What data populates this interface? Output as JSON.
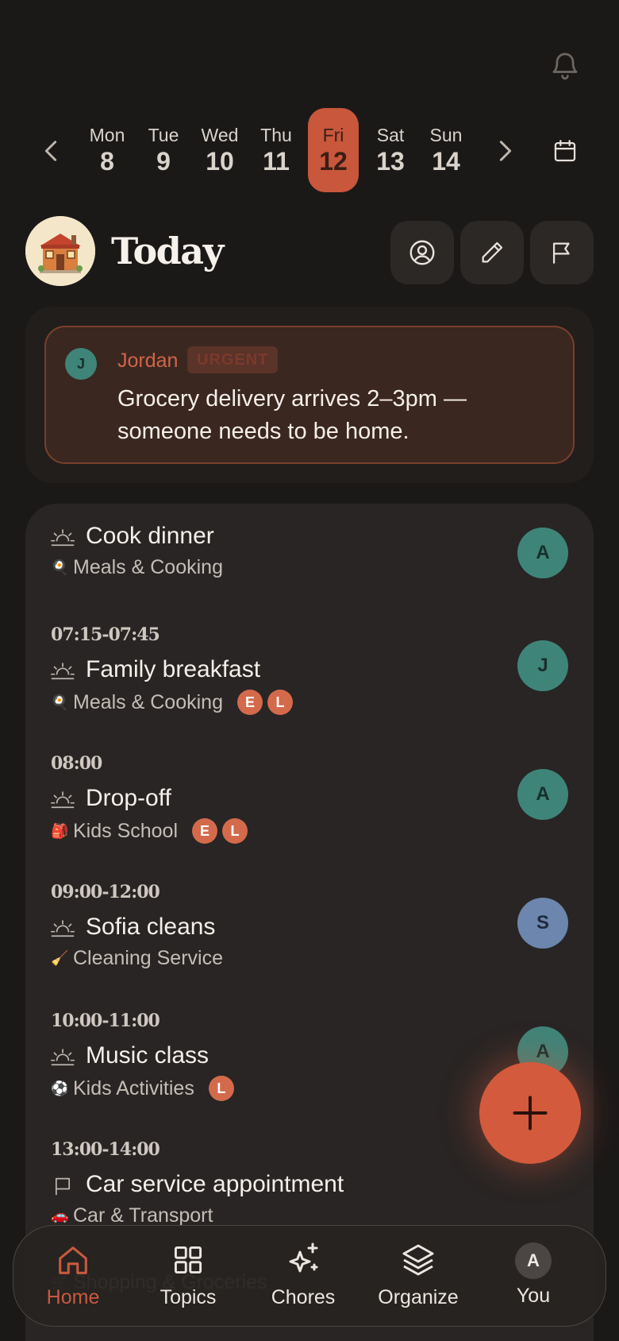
{
  "colors": {
    "background": "#1b1918",
    "accent": "#c8573b",
    "card": "#282524",
    "urgent_card": "#3a2720"
  },
  "header": {
    "notification_icon": "bell-icon",
    "title": "Today",
    "buttons": [
      {
        "icon": "user-circle-icon"
      },
      {
        "icon": "pencil-icon"
      },
      {
        "icon": "flag-icon"
      }
    ]
  },
  "week": {
    "prev_icon": "chevron-left-icon",
    "next_icon": "chevron-right-icon",
    "calendar_icon": "calendar-icon",
    "selected_index": 4,
    "days": [
      {
        "name": "Mon",
        "num": "8"
      },
      {
        "name": "Tue",
        "num": "9"
      },
      {
        "name": "Wed",
        "num": "10"
      },
      {
        "name": "Thu",
        "num": "11"
      },
      {
        "name": "Fri",
        "num": "12"
      },
      {
        "name": "Sat",
        "num": "13"
      },
      {
        "name": "Sun",
        "num": "14"
      }
    ]
  },
  "message": {
    "avatar": "J",
    "sender": "Jordan",
    "tag": "URGENT",
    "text_line1": "Grocery delivery arrives 2–3pm —",
    "text_line2": "someone needs to be home."
  },
  "tasks": [
    {
      "time": "",
      "icon": "sunrise-icon",
      "name": "Cook dinner",
      "category_icon": "🍳",
      "category": "Meals & Cooking",
      "badges": [],
      "assignee": "A"
    },
    {
      "time": "07:15-07:45",
      "icon": "sunrise-icon",
      "name": "Family breakfast",
      "category_icon": "🍳",
      "category": "Meals & Cooking",
      "badges": [
        "E",
        "L"
      ],
      "assignee": "J"
    },
    {
      "time": "08:00",
      "icon": "sunrise-icon",
      "name": "Drop-off",
      "category_icon": "🎒",
      "category": "Kids School",
      "badges": [
        "E",
        "L"
      ],
      "assignee": "A"
    },
    {
      "time": "09:00-12:00",
      "icon": "sunrise-icon",
      "name": "Sofia cleans",
      "category_icon": "🧹",
      "category": "Cleaning Service",
      "badges": [],
      "assignee": "S"
    },
    {
      "time": "10:00-11:00",
      "icon": "sunrise-icon",
      "name": "Music class",
      "category_icon": "⚽",
      "category": "Kids Activities",
      "badges": [
        "L"
      ],
      "assignee": "A"
    },
    {
      "time": "13:00-14:00",
      "icon": "flag-icon",
      "name": "Car service appointment",
      "category_icon": "🚗",
      "category": "Car & Transport",
      "badges": [],
      "assignee": ""
    },
    {
      "time": "",
      "icon": "",
      "name": "",
      "category_icon": "🛒",
      "category": "Shopping & Groceries",
      "badges": [],
      "assignee": ""
    }
  ],
  "fab": {
    "icon": "plus-icon"
  },
  "nav": {
    "active_index": 0,
    "items": [
      {
        "label": "Home",
        "icon": "home-icon"
      },
      {
        "label": "Topics",
        "icon": "grid-icon"
      },
      {
        "label": "Chores",
        "icon": "sparkles-icon"
      },
      {
        "label": "Organize",
        "icon": "layers-icon"
      },
      {
        "label": "You",
        "icon": "avatar",
        "avatar": "A"
      }
    ]
  }
}
